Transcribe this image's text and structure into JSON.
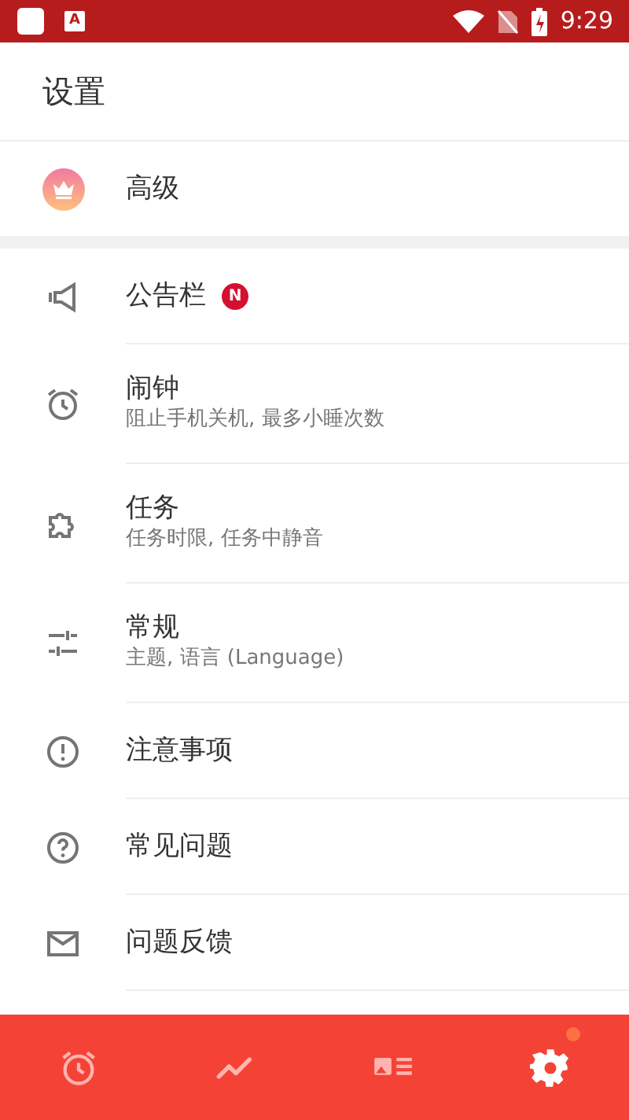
{
  "status_bar": {
    "notification_letter": "A",
    "time": "9:29"
  },
  "header": {
    "title": "设置"
  },
  "premium": {
    "label": "高级"
  },
  "items": [
    {
      "label": "公告栏",
      "badge": "N"
    },
    {
      "label": "闹钟",
      "subtitle": "阻止手机关机, 最多小睡次数"
    },
    {
      "label": "任务",
      "subtitle": "任务时限, 任务中静音"
    },
    {
      "label": "常规",
      "subtitle": "主题, 语言 (Language)"
    },
    {
      "label": "注意事项"
    },
    {
      "label": "常见问题"
    },
    {
      "label": "问题反馈"
    }
  ],
  "bottom_nav": [
    {
      "selected": false,
      "has_dot": false
    },
    {
      "selected": false,
      "has_dot": false
    },
    {
      "selected": false,
      "has_dot": false
    },
    {
      "selected": true,
      "has_dot": true
    }
  ]
}
